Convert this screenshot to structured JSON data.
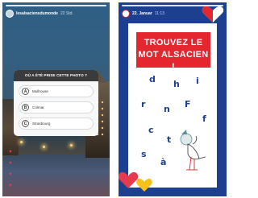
{
  "left_story": {
    "account": "lesalsaciensdumonde",
    "time": "22 Std.",
    "quiz": {
      "question": "OÙ A ÉTÉ PRISE CETTE PHOTO ?",
      "options": [
        {
          "letter": "A",
          "label": "Mulhouse"
        },
        {
          "letter": "B",
          "label": "Colmar"
        },
        {
          "letter": "C",
          "label": "Strasbourg"
        }
      ]
    },
    "reactions": [
      "♥",
      "♥",
      "♥",
      "♥"
    ]
  },
  "right_story": {
    "date": "22. Januar",
    "time": "11:13",
    "title_line1": "TROUVEZ LE",
    "title_line2": "MOT ALSACIEN !",
    "letters": [
      "d",
      "h",
      "i",
      "r",
      "n",
      "F",
      "f",
      "c",
      "t",
      "s",
      "à"
    ]
  },
  "colors": {
    "accent_red": "#e4262f",
    "navy": "#1d3f8f",
    "heart_yellow": "#f6c21a"
  }
}
